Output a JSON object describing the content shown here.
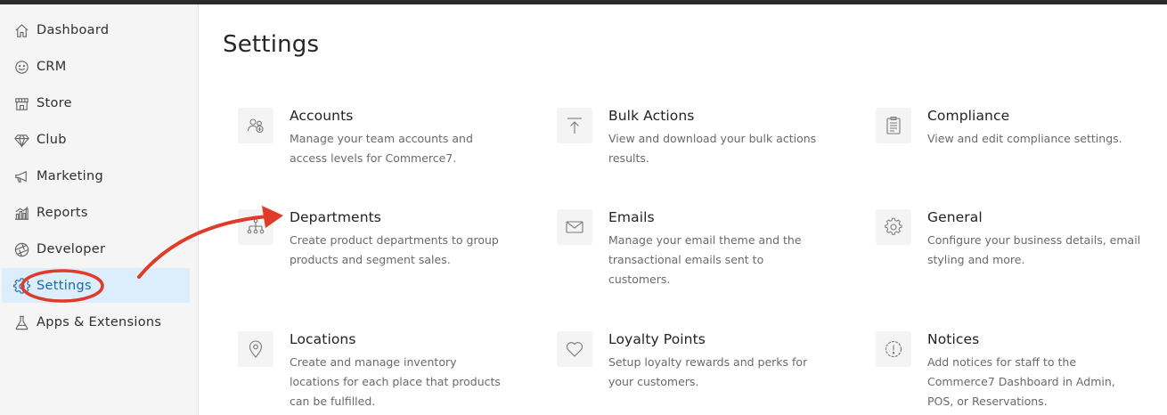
{
  "sidebar": {
    "items": [
      {
        "label": "Dashboard",
        "icon": "home-icon"
      },
      {
        "label": "CRM",
        "icon": "smiley-icon"
      },
      {
        "label": "Store",
        "icon": "storefront-icon"
      },
      {
        "label": "Club",
        "icon": "diamond-icon"
      },
      {
        "label": "Marketing",
        "icon": "megaphone-icon"
      },
      {
        "label": "Reports",
        "icon": "bar-chart-icon"
      },
      {
        "label": "Developer",
        "icon": "aperture-icon"
      },
      {
        "label": "Settings",
        "icon": "gear-icon",
        "active": true
      },
      {
        "label": "Apps & Extensions",
        "icon": "flask-icon"
      }
    ]
  },
  "main": {
    "title": "Settings",
    "cards": [
      {
        "title": "Accounts",
        "description": "Manage your team accounts and access levels for Commerce7.",
        "icon": "users-add-icon"
      },
      {
        "title": "Bulk Actions",
        "description": "View and download your bulk actions results.",
        "icon": "upload-icon"
      },
      {
        "title": "Compliance",
        "description": "View and edit compliance settings.",
        "icon": "clipboard-icon"
      },
      {
        "title": "Departments",
        "description": "Create product departments to group products and segment sales.",
        "icon": "hierarchy-icon"
      },
      {
        "title": "Emails",
        "description": "Manage your email theme and the transactional emails sent to customers.",
        "icon": "envelope-icon"
      },
      {
        "title": "General",
        "description": "Configure your business details, email styling and more.",
        "icon": "gear-icon"
      },
      {
        "title": "Locations",
        "description": "Create and manage inventory locations for each place that products can be fulfilled.",
        "icon": "map-pin-icon"
      },
      {
        "title": "Loyalty Points",
        "description": "Setup loyalty rewards and perks for your customers.",
        "icon": "heart-icon"
      },
      {
        "title": "Notices",
        "description": "Add notices for staff to the Commerce7 Dashboard in Admin, POS, or Reservations.",
        "icon": "alert-circle-icon"
      }
    ]
  },
  "annotation": {
    "color": "#e03a28"
  }
}
